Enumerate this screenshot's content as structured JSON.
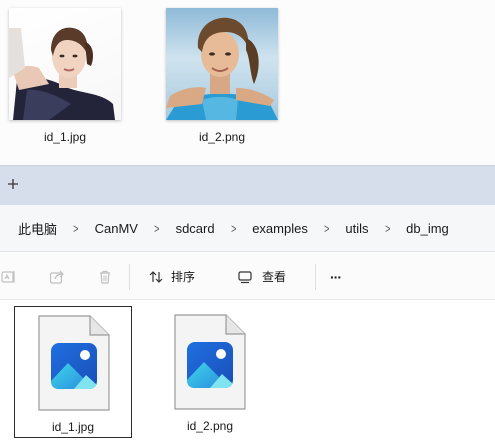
{
  "top_files": [
    {
      "name": "id_1.jpg",
      "image": "woman-portrait-photo"
    },
    {
      "name": "id_2.png",
      "image": "woman-outdoor-photo"
    }
  ],
  "tabs": {
    "new_tab_icon": "plus-icon"
  },
  "breadcrumb": [
    "此电脑",
    "CanMV",
    "sdcard",
    "examples",
    "utils",
    "db_img"
  ],
  "breadcrumb_separator": ">",
  "toolbar": {
    "sort_label": "排序",
    "view_label": "查看",
    "more_label": "···"
  },
  "files": [
    {
      "name": "id_1.jpg",
      "icon": "image-file-icon",
      "selected": true
    },
    {
      "name": "id_2.png",
      "icon": "image-file-icon",
      "selected": false
    }
  ],
  "colors": {
    "tab_strip": "#d5deea",
    "image_icon_blue": "#1f7fe0",
    "image_icon_teal": "#3fd0e0"
  }
}
